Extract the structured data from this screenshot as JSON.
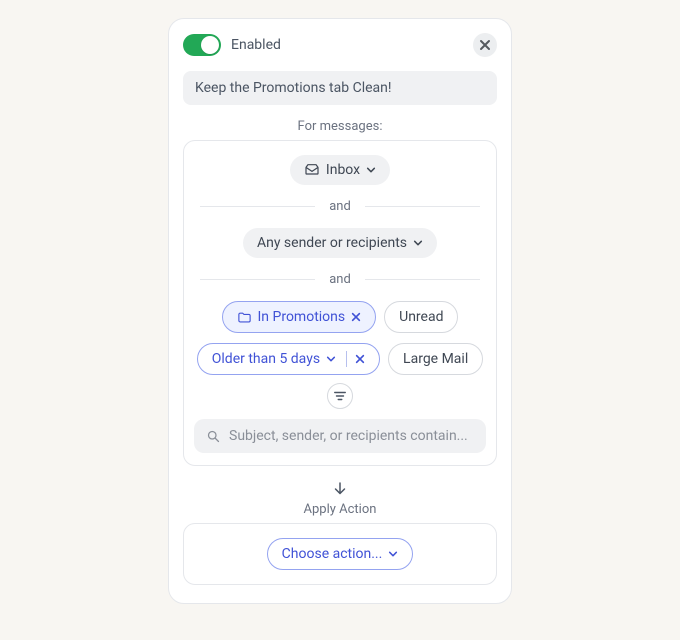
{
  "header": {
    "enabled_label": "Enabled",
    "toggle_on": true
  },
  "title": "Keep the Promotions tab Clean!",
  "sections": {
    "for_messages": "For messages:",
    "and": "and",
    "apply_action": "Apply Action"
  },
  "filters": {
    "mailbox": {
      "label": "Inbox",
      "icon": "inbox"
    },
    "sender": {
      "label": "Any sender or recipients"
    },
    "chips": {
      "in_promotions": "In Promotions",
      "unread": "Unread",
      "older": "Older than 5 days",
      "large_mail": "Large Mail"
    },
    "search_placeholder": "Subject, sender, or recipients contain..."
  },
  "action": {
    "choose_label": "Choose action..."
  }
}
